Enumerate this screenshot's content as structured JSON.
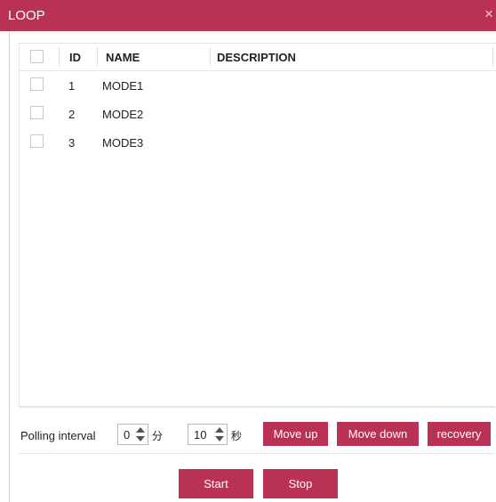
{
  "window": {
    "title": "LOOP",
    "close_glyph": "×"
  },
  "table": {
    "columns": {
      "id": "ID",
      "name": "NAME",
      "description": "DESCRIPTION"
    },
    "rows": [
      {
        "id": "1",
        "name": "MODE1",
        "description": ""
      },
      {
        "id": "2",
        "name": "MODE2",
        "description": ""
      },
      {
        "id": "3",
        "name": "MODE3",
        "description": ""
      }
    ]
  },
  "polling": {
    "label": "Polling interval",
    "minutes_value": "0",
    "minutes_unit": "分",
    "seconds_value": "10",
    "seconds_unit": "秒"
  },
  "buttons": {
    "move_up": "Move up",
    "move_down": "Move down",
    "recovery": "recovery",
    "start": "Start",
    "stop": "Stop"
  },
  "colors": {
    "accent": "#b93255",
    "border": "#e4e4e4"
  }
}
